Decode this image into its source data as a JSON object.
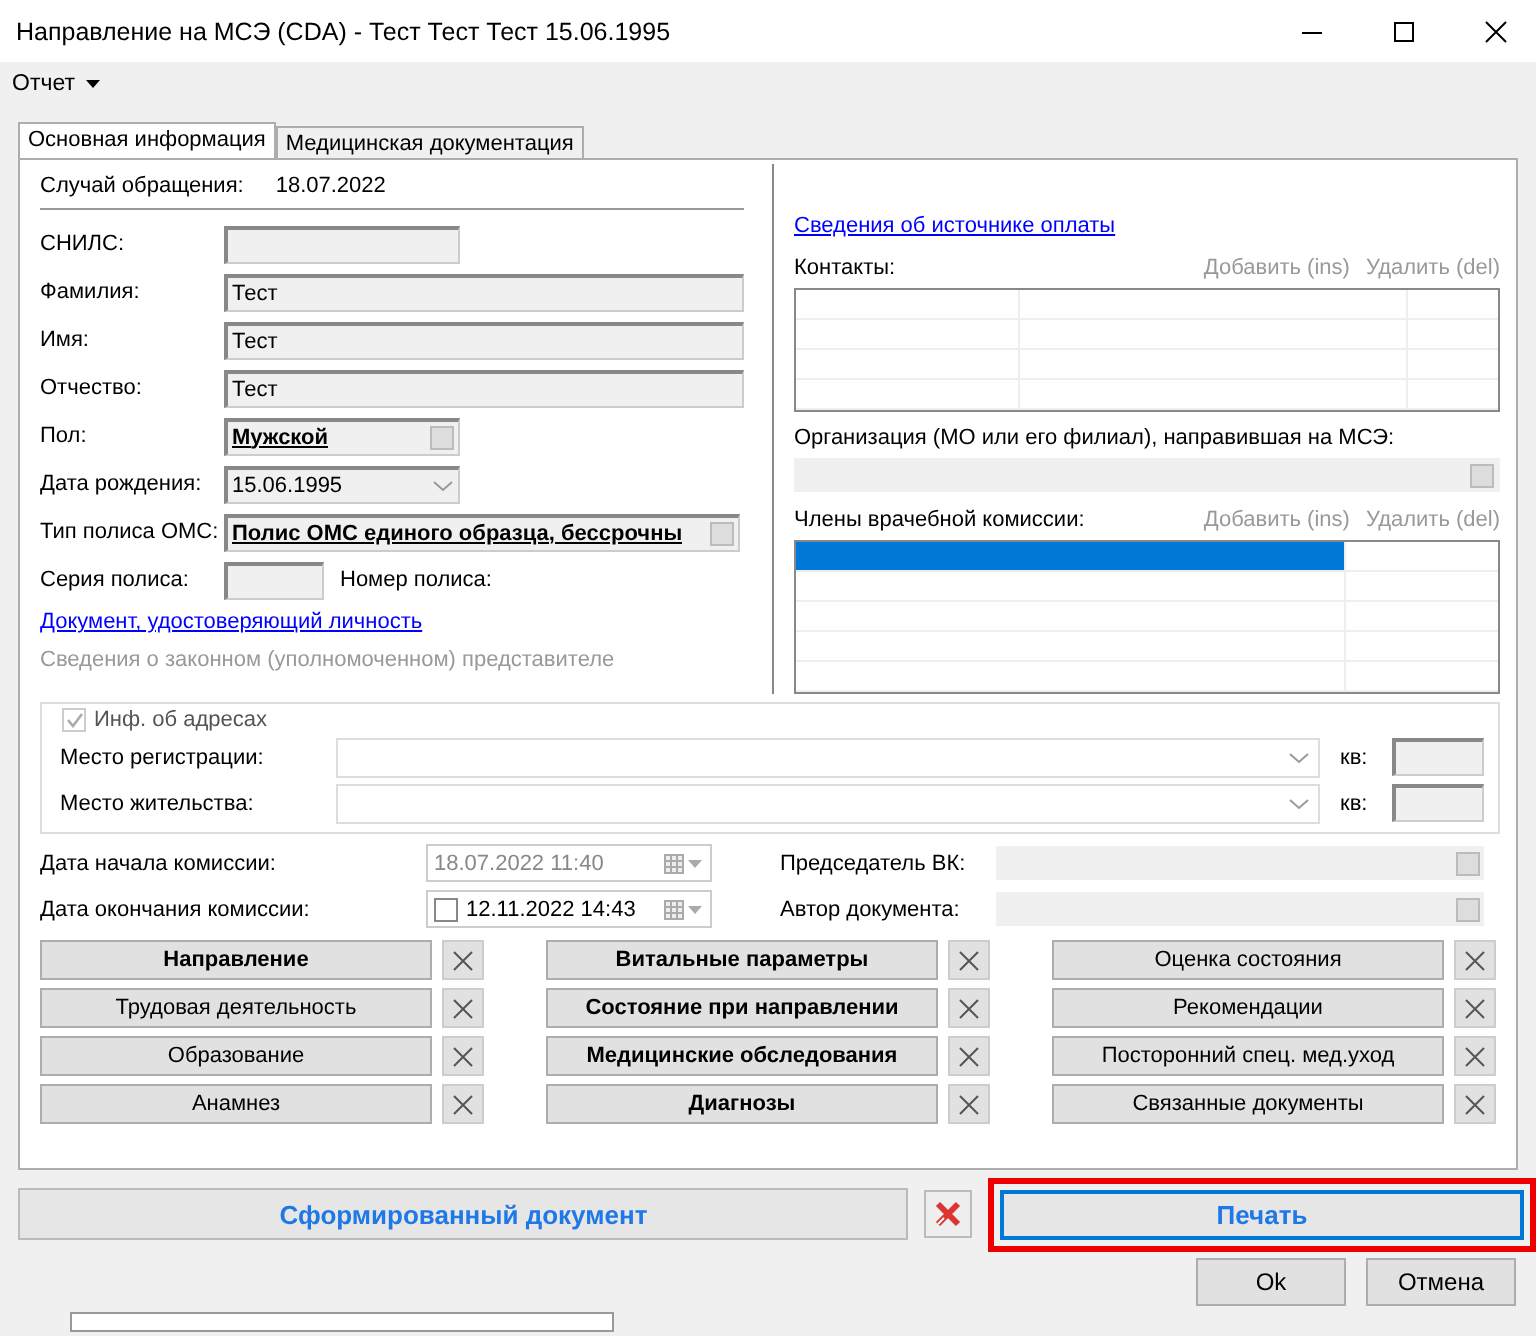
{
  "window": {
    "title": "Направление на МСЭ (CDA) - Тест Тест Тест 15.06.1995"
  },
  "menu": [
    {
      "label": "Отчет"
    }
  ],
  "tabs": [
    {
      "label": "Основная информация",
      "selected": true
    },
    {
      "label": "Медицинская документация",
      "selected": false
    }
  ],
  "case": {
    "label": "Случай обращения:",
    "value": "18.07.2022"
  },
  "patient_fields": [
    {
      "kind": "short",
      "label": "СНИЛС:"
    },
    {
      "kind": "text",
      "label": "Фамилия:",
      "value": "Тест"
    },
    {
      "kind": "text",
      "label": "Имя:",
      "value": "Тест"
    },
    {
      "kind": "text",
      "label": "Отчество:",
      "value": "Тест"
    },
    {
      "kind": "lookup_short",
      "label": "Пол:",
      "value": "Мужской"
    },
    {
      "kind": "date",
      "label": "Дата рождения:",
      "value": "15.06.1995"
    },
    {
      "kind": "lookup",
      "label": "Тип полиса ОМС:",
      "value": "Полис ОМС единого образца, бессрочны"
    }
  ],
  "policy": {
    "series_label": "Серия полиса:",
    "number_label": "Номер полиса:"
  },
  "links": [
    {
      "label": "Документ, удостоверяющий личность",
      "disabled": false
    },
    {
      "label": "Сведения о законном (уполномоченном) представителе",
      "disabled": true
    }
  ],
  "payment_link": "Сведения об источнике оплаты",
  "contacts": {
    "label": "Контакты:",
    "actions": [
      {
        "label": "Добавить (ins)",
        "disabled": true
      },
      {
        "label": "Удалить (del)",
        "disabled": true
      }
    ],
    "rows": [
      {
        "selected": false
      },
      {
        "selected": false
      },
      {
        "selected": false
      },
      {
        "selected": false
      }
    ]
  },
  "organization": {
    "label": "Организация (МО или его филиал), направившая на МСЭ:"
  },
  "commission": {
    "label": "Члены врачебной комиссии:",
    "actions": [
      {
        "label": "Добавить (ins)",
        "disabled": true
      },
      {
        "label": "Удалить (del)",
        "disabled": true
      }
    ],
    "rows": [
      {
        "selected": true
      },
      {
        "selected": false
      },
      {
        "selected": false
      },
      {
        "selected": false
      },
      {
        "selected": false
      }
    ]
  },
  "addresses": {
    "label": "Инф. об адресах",
    "checked": true,
    "disabled": true,
    "rows": [
      {
        "label": "Место регистрации:",
        "apt_label": "кв:"
      },
      {
        "label": "Место жительства:",
        "apt_label": "кв:"
      }
    ]
  },
  "commission_dates": [
    {
      "kind": "date",
      "label": "Дата начала комиссии:",
      "value": "18.07.2022 11:40",
      "disabled": true
    },
    {
      "kind": "date_checkbox",
      "label": "Дата окончания комиссии:",
      "value": "12.11.2022 14:43",
      "disabled": false,
      "checked": false
    }
  ],
  "signers": [
    {
      "label": "Председатель ВК:"
    },
    {
      "label": "Автор документа:"
    }
  ],
  "sections": [
    [
      {
        "label": "Направление",
        "bold": true
      },
      {
        "label": "Трудовая деятельность",
        "bold": false
      },
      {
        "label": "Образование",
        "bold": false
      },
      {
        "label": "Анамнез",
        "bold": false
      }
    ],
    [
      {
        "label": "Витальные параметры",
        "bold": true
      },
      {
        "label": "Состояние при направлении",
        "bold": true
      },
      {
        "label": "Медицинские обследования",
        "bold": true
      },
      {
        "label": "Диагнозы",
        "bold": true
      }
    ],
    [
      {
        "label": "Оценка состояния",
        "bold": false
      },
      {
        "label": "Рекомендации",
        "bold": false
      },
      {
        "label": "Посторонний спец. мед.уход",
        "bold": false
      },
      {
        "label": "Связанные документы",
        "bold": false
      }
    ]
  ],
  "generated_document": {
    "label": "Сформированный документ"
  },
  "print": {
    "label": "Печать",
    "highlighted": true
  },
  "dialog_buttons": [
    {
      "label": "Ok"
    },
    {
      "label": "Отмена"
    }
  ]
}
